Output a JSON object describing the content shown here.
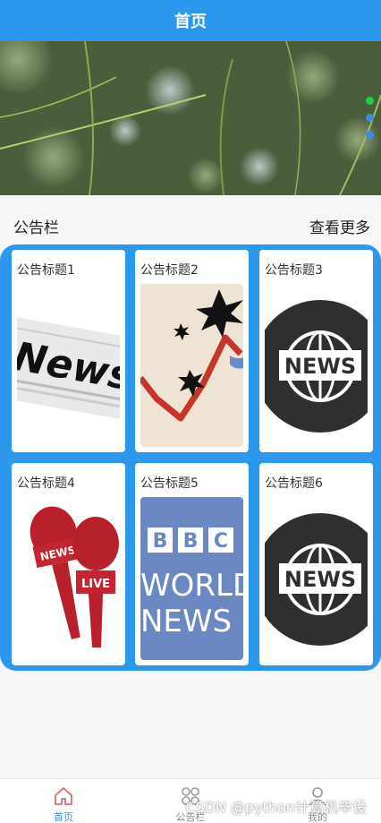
{
  "header": {
    "title": "首页"
  },
  "banner": {
    "indicators": [
      "#22cc44",
      "#3b8ee6",
      "#3b8ee6"
    ]
  },
  "notice": {
    "section_title": "公告栏",
    "more_label": "查看更多",
    "cards": [
      {
        "title": "公告标题1",
        "image": "news-newspaper"
      },
      {
        "title": "公告标题2",
        "image": "chart-explosion"
      },
      {
        "title": "公告标题3",
        "image": "globe-news"
      },
      {
        "title": "公告标题4",
        "image": "microphones"
      },
      {
        "title": "公告标题5",
        "image": "bbc-world-news",
        "image_text": [
          "BBC",
          "WORLD",
          "NEWS"
        ]
      },
      {
        "title": "公告标题6",
        "image": "globe-news"
      }
    ],
    "image_labels": {
      "newspaper": "News",
      "globe": "NEWS",
      "mic_news": "NEWS",
      "mic_live": "LIVE"
    }
  },
  "tabbar": {
    "items": [
      {
        "label": "首页",
        "icon": "home-icon",
        "active": true
      },
      {
        "label": "公告栏",
        "icon": "grid-icon",
        "active": false
      },
      {
        "label": "我的",
        "icon": "user-icon",
        "active": false
      }
    ]
  },
  "watermark": "CSDN @python计算机毕设",
  "colors": {
    "primary": "#2b98ee",
    "active_tab": "#3b8ee6"
  }
}
